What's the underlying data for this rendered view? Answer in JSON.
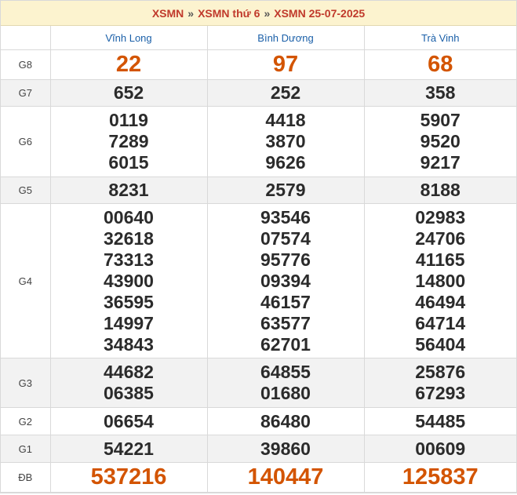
{
  "header": {
    "crumb1": "XSMN",
    "crumb2": "XSMN thứ 6",
    "crumb3": "XSMN 25-07-2025",
    "separator": "»"
  },
  "provinces": [
    "Vĩnh Long",
    "Bình Dương",
    "Trà Vinh"
  ],
  "prizes": [
    {
      "label": "G8",
      "values": [
        [
          "22"
        ],
        [
          "97"
        ],
        [
          "68"
        ]
      ]
    },
    {
      "label": "G7",
      "values": [
        [
          "652"
        ],
        [
          "252"
        ],
        [
          "358"
        ]
      ]
    },
    {
      "label": "G6",
      "values": [
        [
          "0119",
          "7289",
          "6015"
        ],
        [
          "4418",
          "3870",
          "9626"
        ],
        [
          "5907",
          "9520",
          "9217"
        ]
      ]
    },
    {
      "label": "G5",
      "values": [
        [
          "8231"
        ],
        [
          "2579"
        ],
        [
          "8188"
        ]
      ]
    },
    {
      "label": "G4",
      "values": [
        [
          "00640",
          "32618",
          "73313",
          "43900",
          "36595",
          "14997",
          "34843"
        ],
        [
          "93546",
          "07574",
          "95776",
          "09394",
          "46157",
          "63577",
          "62701"
        ],
        [
          "02983",
          "24706",
          "41165",
          "14800",
          "46494",
          "64714",
          "56404"
        ]
      ]
    },
    {
      "label": "G3",
      "values": [
        [
          "44682",
          "06385"
        ],
        [
          "64855",
          "01680"
        ],
        [
          "25876",
          "67293"
        ]
      ]
    },
    {
      "label": "G2",
      "values": [
        [
          "06654"
        ],
        [
          "86480"
        ],
        [
          "54485"
        ]
      ]
    },
    {
      "label": "G1",
      "values": [
        [
          "54221"
        ],
        [
          "39860"
        ],
        [
          "00609"
        ]
      ]
    },
    {
      "label": "ĐB",
      "values": [
        [
          "537216"
        ],
        [
          "140447"
        ],
        [
          "125837"
        ]
      ]
    }
  ],
  "colors": {
    "accent": "#d35400",
    "title": "#c0392b",
    "province": "#1a5fa8",
    "header_bg": "#fcf3cf",
    "alt_row_bg": "#f2f2f2"
  }
}
